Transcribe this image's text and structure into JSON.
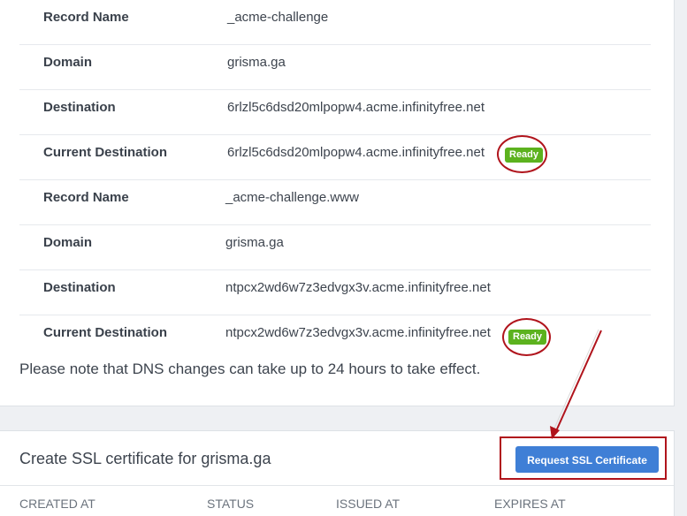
{
  "records": [
    {
      "label": "Record Name",
      "value": "_acme-challenge"
    },
    {
      "label": "Domain",
      "value": "grisma.ga"
    },
    {
      "label": "Destination",
      "value": "6rlzl5c6dsd20mlpopw4.acme.infinityfree.net"
    },
    {
      "label": "Current Destination",
      "value": "6rlzl5c6dsd20mlpopw4.acme.infinityfree.net",
      "badge": "Ready"
    },
    {
      "label": "Record Name",
      "value": "_acme-challenge.www"
    },
    {
      "label": "Domain",
      "value": "grisma.ga"
    },
    {
      "label": "Destination",
      "value": "ntpcx2wd6w7z3edvgx3v.acme.infinityfree.net"
    },
    {
      "label": "Current Destination",
      "value": "ntpcx2wd6w7z3edvgx3v.acme.infinityfree.net",
      "badge": "Ready"
    }
  ],
  "note": "Please note that DNS changes can take up to 24 hours to take effect.",
  "ssl": {
    "title": "Create SSL certificate for grisma.ga",
    "button_label": "Request SSL Certificate",
    "columns": [
      "CREATED AT",
      "STATUS",
      "ISSUED AT",
      "EXPIRES AT"
    ]
  },
  "colors": {
    "badge": "#5cb21e",
    "button": "#3f7fd6",
    "annotation": "#b0141c"
  }
}
